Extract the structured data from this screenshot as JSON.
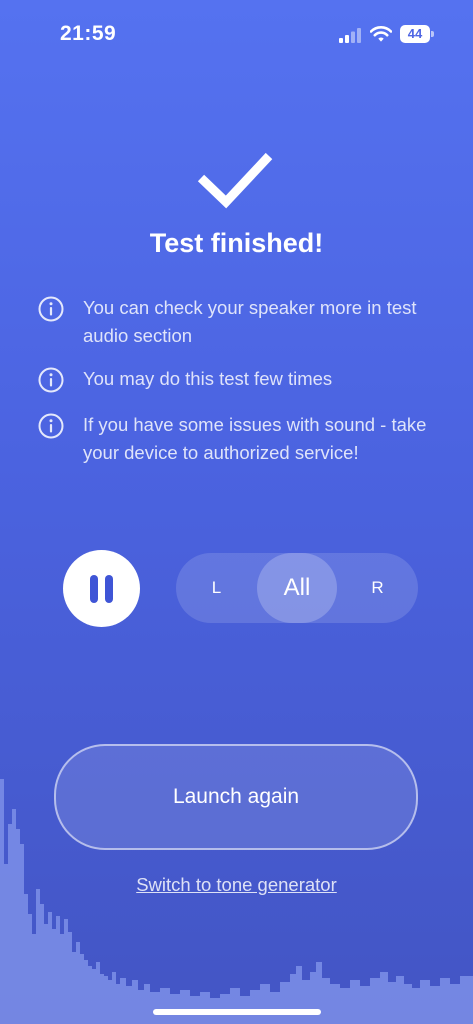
{
  "status_bar": {
    "time": "21:59",
    "battery_level": "44",
    "signal_icon": "cellular-signal-icon",
    "wifi_icon": "wifi-icon"
  },
  "result": {
    "icon": "checkmark-icon",
    "title": "Test finished!"
  },
  "info_items": [
    {
      "icon": "info-icon",
      "text": "You can check your speaker more in test audio section"
    },
    {
      "icon": "info-icon",
      "text": "You may do this test few times"
    },
    {
      "icon": "info-icon",
      "text": "If you have some issues with sound - take your device to authorized service!"
    }
  ],
  "player": {
    "pause_icon": "pause-icon",
    "channels": [
      "L",
      "All",
      "R"
    ],
    "selected_channel": "All"
  },
  "actions": {
    "launch_label": "Launch again",
    "switch_label": "Switch to tone generator"
  },
  "colors": {
    "background_top": "#5572f0",
    "background_bottom": "#4355c4",
    "accent": "#3f55d6",
    "waveform": "#7d8fe8"
  }
}
